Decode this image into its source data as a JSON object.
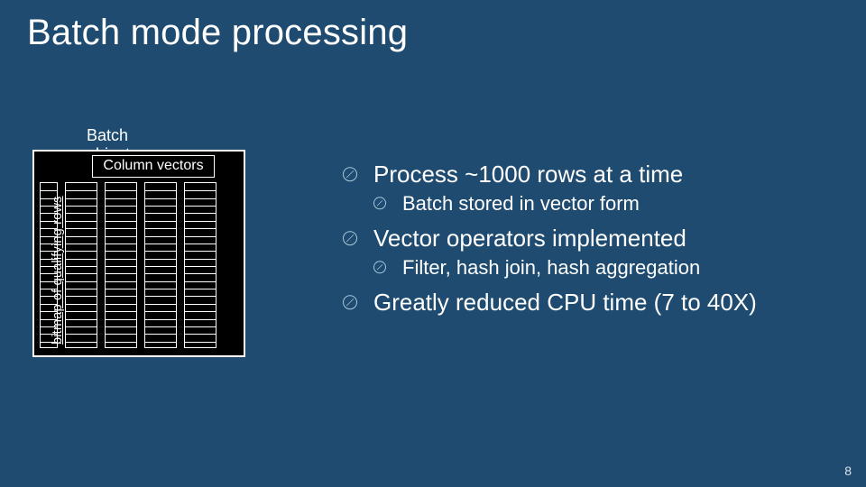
{
  "title": "Batch mode processing",
  "diagram": {
    "batch_label": "Batch object",
    "column_vectors_label": "Column vectors",
    "bitmap_label": "bitmap of qualifying rows"
  },
  "bullets": {
    "b1": "Process ~1000 rows at a time",
    "b1a": "Batch stored in vector form",
    "b2": "Vector operators implemented",
    "b2a": "Filter, hash join, hash aggregation",
    "b3": "Greatly reduced CPU time (7 to 40X)"
  },
  "page_number": "8"
}
